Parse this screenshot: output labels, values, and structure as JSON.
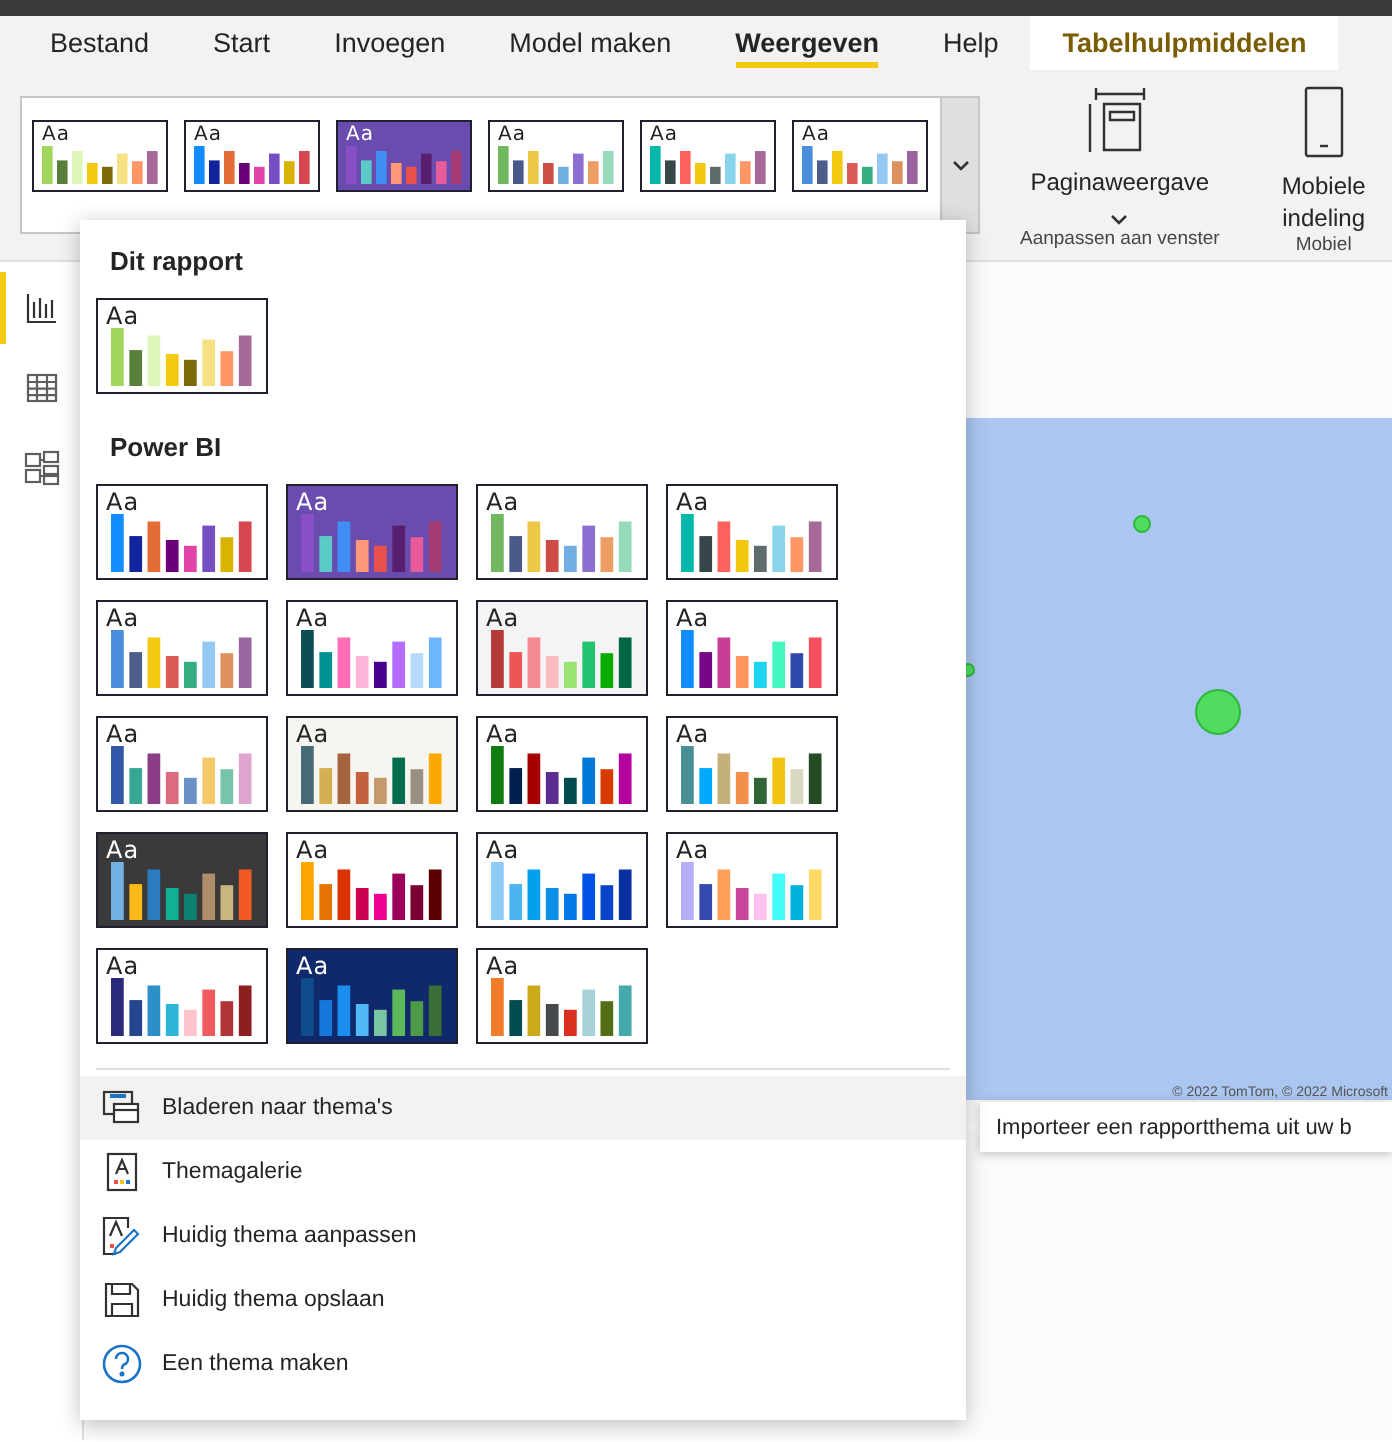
{
  "tabs": [
    {
      "label": "Bestand",
      "selected": false,
      "kind": "normal"
    },
    {
      "label": "Start",
      "selected": false,
      "kind": "normal"
    },
    {
      "label": "Invoegen",
      "selected": false,
      "kind": "normal"
    },
    {
      "label": "Model maken",
      "selected": false,
      "kind": "normal"
    },
    {
      "label": "Weergeven",
      "selected": true,
      "kind": "normal"
    },
    {
      "label": "Help",
      "selected": false,
      "kind": "normal"
    },
    {
      "label": "Tabelhulpmiddelen",
      "selected": false,
      "kind": "contextual"
    }
  ],
  "ribbon": {
    "gallery": [
      {
        "sample": "Aa",
        "color": "#ffffff",
        "bars": [
          {
            "color": "#a0d65c"
          },
          {
            "color": "#5a7f3a"
          },
          {
            "color": "#dcf7b8"
          },
          {
            "color": "#f2c811"
          },
          {
            "color": "#7c6a0a"
          },
          {
            "color": "#f6e084"
          },
          {
            "color": "#fe9666"
          },
          {
            "color": "#a66999"
          }
        ]
      },
      {
        "sample": "Aa",
        "color": "#ffffff",
        "bars": [
          {
            "color": "#118dff"
          },
          {
            "color": "#12239e"
          },
          {
            "color": "#e66c37"
          },
          {
            "color": "#6b007b"
          },
          {
            "color": "#e044a7"
          },
          {
            "color": "#744ec2"
          },
          {
            "color": "#d9b300"
          },
          {
            "color": "#d64550"
          }
        ]
      },
      {
        "sample": "Aa",
        "color": "#6a4cae",
        "bars": [
          {
            "color": "#8a4fc6"
          },
          {
            "color": "#5bcbc8"
          },
          {
            "color": "#3f8ef5"
          },
          {
            "color": "#fe9878"
          },
          {
            "color": "#e8524a"
          },
          {
            "color": "#5a1e6e"
          },
          {
            "color": "#e85b9a"
          },
          {
            "color": "#a23b72"
          }
        ]
      },
      {
        "sample": "Aa",
        "color": "#ffffff",
        "bars": [
          {
            "color": "#71b860"
          },
          {
            "color": "#4a588a"
          },
          {
            "color": "#ecc846"
          },
          {
            "color": "#cd4c46"
          },
          {
            "color": "#71afe2"
          },
          {
            "color": "#8d6fd1"
          },
          {
            "color": "#ee9e64"
          },
          {
            "color": "#95dabb"
          }
        ]
      },
      {
        "sample": "Aa",
        "color": "#ffffff",
        "bars": [
          {
            "color": "#01b8aa"
          },
          {
            "color": "#374649"
          },
          {
            "color": "#fd625e"
          },
          {
            "color": "#f2c80f"
          },
          {
            "color": "#5f6b6d"
          },
          {
            "color": "#8ad4eb"
          },
          {
            "color": "#fe9666"
          },
          {
            "color": "#a66999"
          }
        ]
      },
      {
        "sample": "Aa",
        "color": "#ffffff",
        "bars": [
          {
            "color": "#4a8ddc"
          },
          {
            "color": "#4c5d8a"
          },
          {
            "color": "#f3c911"
          },
          {
            "color": "#dc5b57"
          },
          {
            "color": "#33ae81"
          },
          {
            "color": "#95c8f0"
          },
          {
            "color": "#dd915f"
          },
          {
            "color": "#9a64a0"
          }
        ]
      }
    ],
    "groups": [
      {
        "kind": "page-view",
        "button": "Paginaweergave",
        "label": "Aanpassen aan venster"
      },
      {
        "kind": "mobile",
        "button": "Mobiele indeling",
        "label": "Mobiel"
      }
    ]
  },
  "sidebar": {
    "items": [
      {
        "kind": "report",
        "selected": true
      },
      {
        "kind": "data",
        "selected": false
      },
      {
        "kind": "model",
        "selected": false
      }
    ]
  },
  "theme_menu": {
    "sections": [
      {
        "title": "Dit rapport",
        "themes": [
          {
            "sample": "Aa",
            "color": "#ffffff",
            "bars": [
              {
                "color": "#a0d65c"
              },
              {
                "color": "#5a7f3a"
              },
              {
                "color": "#dcf7b8"
              },
              {
                "color": "#f2c811"
              },
              {
                "color": "#7c6a0a"
              },
              {
                "color": "#f6e084"
              },
              {
                "color": "#fe9666"
              },
              {
                "color": "#a66999"
              }
            ]
          }
        ]
      },
      {
        "title": "Power BI",
        "themes": [
          {
            "sample": "Aa",
            "color": "#ffffff",
            "bars": [
              {
                "color": "#118dff"
              },
              {
                "color": "#12239e"
              },
              {
                "color": "#e66c37"
              },
              {
                "color": "#6b007b"
              },
              {
                "color": "#e044a7"
              },
              {
                "color": "#744ec2"
              },
              {
                "color": "#d9b300"
              },
              {
                "color": "#d64550"
              }
            ]
          },
          {
            "sample": "Aa",
            "color": "#6a4cae",
            "bars": [
              {
                "color": "#8a4fc6"
              },
              {
                "color": "#5bcbc8"
              },
              {
                "color": "#3f8ef5"
              },
              {
                "color": "#fe9878"
              },
              {
                "color": "#e8524a"
              },
              {
                "color": "#5a1e6e"
              },
              {
                "color": "#e85b9a"
              },
              {
                "color": "#a23b72"
              }
            ]
          },
          {
            "sample": "Aa",
            "color": "#ffffff",
            "bars": [
              {
                "color": "#71b860"
              },
              {
                "color": "#4a588a"
              },
              {
                "color": "#ecc846"
              },
              {
                "color": "#cd4c46"
              },
              {
                "color": "#71afe2"
              },
              {
                "color": "#8d6fd1"
              },
              {
                "color": "#ee9e64"
              },
              {
                "color": "#95dabb"
              }
            ]
          },
          {
            "sample": "Aa",
            "color": "#ffffff",
            "bars": [
              {
                "color": "#01b8aa"
              },
              {
                "color": "#374649"
              },
              {
                "color": "#fd625e"
              },
              {
                "color": "#f2c80f"
              },
              {
                "color": "#5f6b6d"
              },
              {
                "color": "#8ad4eb"
              },
              {
                "color": "#fe9666"
              },
              {
                "color": "#a66999"
              }
            ]
          },
          {
            "sample": "Aa",
            "color": "#ffffff",
            "bars": [
              {
                "color": "#4a8ddc"
              },
              {
                "color": "#4c5d8a"
              },
              {
                "color": "#f3c911"
              },
              {
                "color": "#dc5b57"
              },
              {
                "color": "#33ae81"
              },
              {
                "color": "#95c8f0"
              },
              {
                "color": "#dd915f"
              },
              {
                "color": "#9a64a0"
              }
            ]
          },
          {
            "sample": "Aa",
            "color": "#ffffff",
            "bars": [
              {
                "color": "#0c4e55"
              },
              {
                "color": "#009292"
              },
              {
                "color": "#fe6db6"
              },
              {
                "color": "#feb5da"
              },
              {
                "color": "#480091"
              },
              {
                "color": "#b66dff"
              },
              {
                "color": "#b5dafe"
              },
              {
                "color": "#6db6ff"
              }
            ]
          },
          {
            "sample": "Aa",
            "color": "#f4f4f4",
            "bars": [
              {
                "color": "#b73a3a"
              },
              {
                "color": "#ec5656"
              },
              {
                "color": "#f28a90"
              },
              {
                "color": "#f8bcbd"
              },
              {
                "color": "#99e472"
              },
              {
                "color": "#23c26f"
              },
              {
                "color": "#0aac00"
              },
              {
                "color": "#026645"
              }
            ]
          },
          {
            "sample": "Aa",
            "color": "#ffffff",
            "bars": [
              {
                "color": "#118dff"
              },
              {
                "color": "#750985"
              },
              {
                "color": "#c83d95"
              },
              {
                "color": "#ff985e"
              },
              {
                "color": "#1dd5ee"
              },
              {
                "color": "#42f7c0"
              },
              {
                "color": "#3049ad"
              },
              {
                "color": "#f64f5c"
              }
            ]
          },
          {
            "sample": "Aa",
            "color": "#ffffff",
            "bars": [
              {
                "color": "#3257a8"
              },
              {
                "color": "#37a794"
              },
              {
                "color": "#8b3d88"
              },
              {
                "color": "#dd6b7f"
              },
              {
                "color": "#6b91c9"
              },
              {
                "color": "#f5c869"
              },
              {
                "color": "#77c4a8"
              },
              {
                "color": "#dea6cf"
              }
            ]
          },
          {
            "sample": "Aa",
            "color": "#f7f5ef",
            "bars": [
              {
                "color": "#456a76"
              },
              {
                "color": "#d4b053"
              },
              {
                "color": "#a4653e"
              },
              {
                "color": "#c3613e"
              },
              {
                "color": "#c49a6c"
              },
              {
                "color": "#056d4f"
              },
              {
                "color": "#9a8f83"
              },
              {
                "color": "#fba900"
              }
            ]
          },
          {
            "sample": "Aa",
            "color": "#ffffff",
            "bars": [
              {
                "color": "#107c10"
              },
              {
                "color": "#002050"
              },
              {
                "color": "#a80000"
              },
              {
                "color": "#5c2d91"
              },
              {
                "color": "#004b50"
              },
              {
                "color": "#0078d7"
              },
              {
                "color": "#d83b01"
              },
              {
                "color": "#b4009e"
              }
            ]
          },
          {
            "sample": "Aa",
            "color": "#ffffff",
            "bars": [
              {
                "color": "#4a8f96"
              },
              {
                "color": "#01a9fc"
              },
              {
                "color": "#c4b07b"
              },
              {
                "color": "#f28f4b"
              },
              {
                "color": "#2f6534"
              },
              {
                "color": "#f1c40f"
              },
              {
                "color": "#d9d6c2"
              },
              {
                "color": "#254a26"
              }
            ]
          },
          {
            "sample": "Aa",
            "color": "#3a3a3a",
            "bars": [
              {
                "color": "#73b2e3"
              },
              {
                "color": "#fdb918"
              },
              {
                "color": "#2a7bc0"
              },
              {
                "color": "#10b095"
              },
              {
                "color": "#0e8071"
              },
              {
                "color": "#b08e6c"
              },
              {
                "color": "#c8b57f"
              },
              {
                "color": "#f15a24"
              }
            ]
          },
          {
            "sample": "Aa",
            "color": "#ffffff",
            "bars": [
              {
                "color": "#ffa500"
              },
              {
                "color": "#e67300"
              },
              {
                "color": "#dc3100"
              },
              {
                "color": "#cc0050"
              },
              {
                "color": "#ee0090"
              },
              {
                "color": "#9b005b"
              },
              {
                "color": "#7a0033"
              },
              {
                "color": "#5b0000"
              }
            ]
          },
          {
            "sample": "Aa",
            "color": "#ffffff",
            "bars": [
              {
                "color": "#8fcbf7"
              },
              {
                "color": "#4ab5f0"
              },
              {
                "color": "#03a0ee"
              },
              {
                "color": "#0a8ee8"
              },
              {
                "color": "#0077e6"
              },
              {
                "color": "#0052e6"
              },
              {
                "color": "#0a44c8"
              },
              {
                "color": "#0a31a0"
              }
            ]
          },
          {
            "sample": "Aa",
            "color": "#ffffff",
            "bars": [
              {
                "color": "#b7aef8"
              },
              {
                "color": "#3448ad"
              },
              {
                "color": "#ff9e58"
              },
              {
                "color": "#c9449b"
              },
              {
                "color": "#fec0ec"
              },
              {
                "color": "#43fbf7"
              },
              {
                "color": "#00b0dc"
              },
              {
                "color": "#ffd966"
              }
            ]
          },
          {
            "sample": "Aa",
            "color": "#ffffff",
            "bars": [
              {
                "color": "#2a2a7a"
              },
              {
                "color": "#24468f"
              },
              {
                "color": "#2c8fc7"
              },
              {
                "color": "#2bb5d8"
              },
              {
                "color": "#fec3cd"
              },
              {
                "color": "#ef5a5f"
              },
              {
                "color": "#b03538"
              },
              {
                "color": "#8c2020"
              }
            ]
          },
          {
            "sample": "Aa",
            "color": "#10296b",
            "bars": [
              {
                "color": "#0e4c8c"
              },
              {
                "color": "#1577dc"
              },
              {
                "color": "#1a8ff0"
              },
              {
                "color": "#52b7f5"
              },
              {
                "color": "#79c4a2"
              },
              {
                "color": "#5cba5c"
              },
              {
                "color": "#4f9a48"
              },
              {
                "color": "#3a6e38"
              }
            ]
          },
          {
            "sample": "Aa",
            "color": "#ffffff",
            "bars": [
              {
                "color": "#f07b29"
              },
              {
                "color": "#034c4f"
              },
              {
                "color": "#caaa18"
              },
              {
                "color": "#474a4d"
              },
              {
                "color": "#d9301f"
              },
              {
                "color": "#a6d1d6"
              },
              {
                "color": "#536e17"
              },
              {
                "color": "#46aaaa"
              }
            ]
          }
        ]
      }
    ],
    "items": [
      {
        "kind": "browse",
        "label": "Bladeren naar thema's",
        "highlighted": true
      },
      {
        "kind": "gallery",
        "label": "Themagalerie",
        "highlighted": false
      },
      {
        "kind": "customize",
        "label": "Huidig thema aanpassen",
        "highlighted": false
      },
      {
        "kind": "save",
        "label": "Huidig thema opslaan",
        "highlighted": false
      },
      {
        "kind": "help",
        "label": "Een thema maken",
        "highlighted": false
      }
    ]
  },
  "tooltip": {
    "text": "Importeer een rapportthema uit uw b"
  },
  "map": {
    "attribution": "© 2022 TomTom, © 2022 Microsoft"
  }
}
